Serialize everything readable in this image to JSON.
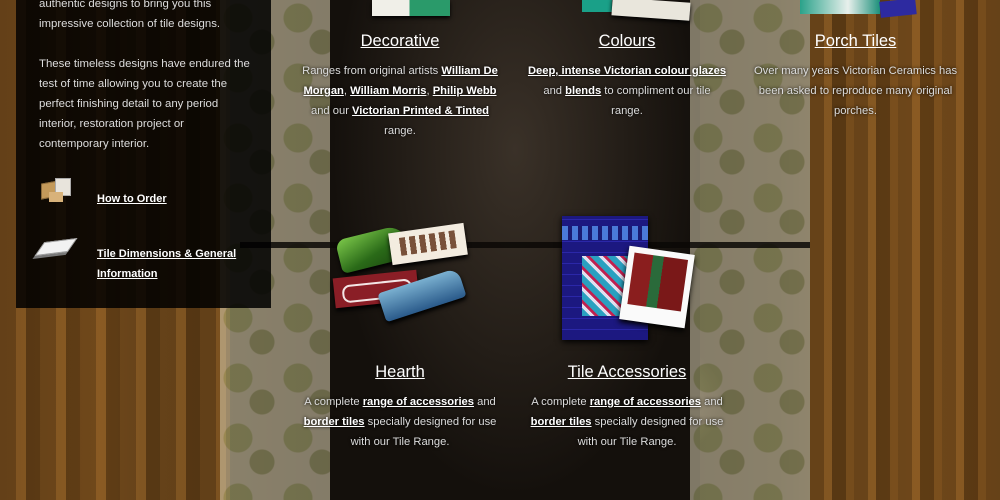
{
  "sidebar": {
    "intro": "authentic designs to bring you this impressive collection of tile designs.",
    "timeless": "These timeless designs have endured the test of time allowing you to create the perfect finishing detail to any period interior, restoration project or contemporary interior.",
    "links": [
      {
        "label": "How to Order",
        "icon": "boxes-icon"
      },
      {
        "label": "Tile Dimensions & General Information",
        "icon": "tile-icon"
      }
    ]
  },
  "cards": {
    "decorative": {
      "title": "Decorative",
      "t1": "Ranges from original artists ",
      "l1": "William De Morgan",
      "t2": ", ",
      "l2": "William Morris",
      "t3": ", ",
      "l3": "Philip Webb",
      "t4": " and our ",
      "l4": "Victorian Printed & Tinted",
      "t5": " range."
    },
    "colours": {
      "title": "Colours",
      "l1": "Deep, intense Victorian colour glazes",
      "t1": " and ",
      "l2": "blends",
      "t2": " to compliment our tile range."
    },
    "porch": {
      "title": "Porch Tiles",
      "desc": "Over many years Victorian Ceramics has been asked to reproduce many original porches."
    },
    "hearth": {
      "title": "Hearth",
      "t1": "A complete ",
      "l1": "range of accessories",
      "t2": " and ",
      "l2": "border tiles",
      "t3": " specially designed for use with our Tile Range."
    },
    "accessories": {
      "title": "Tile Accessories",
      "t1": "A complete ",
      "l1": "range of accessories",
      "t2": " and ",
      "l2": "border tiles",
      "t3": " specially designed for use with our Tile Range."
    }
  }
}
